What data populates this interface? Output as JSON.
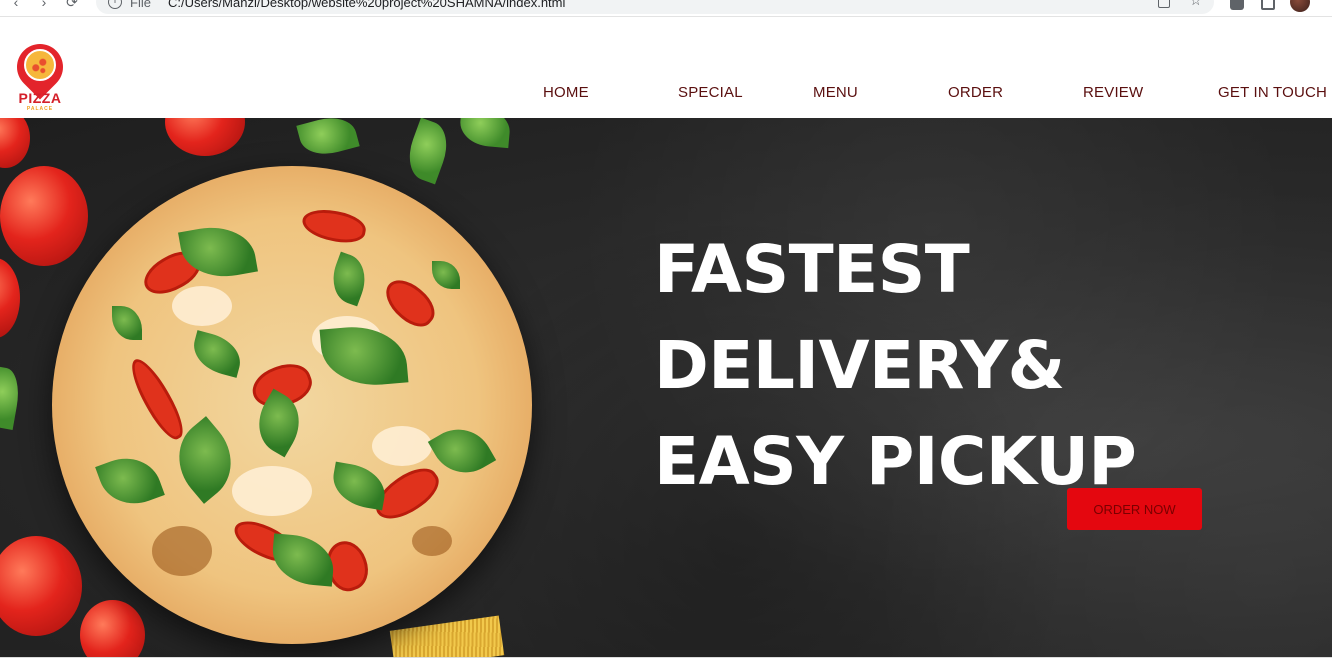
{
  "browser": {
    "protocol_label": "File",
    "url": "C:/Users/Manzi/Desktop/website%20project%20SHAMNA/index.html"
  },
  "logo": {
    "wordmark": "PIZZA",
    "subtext": "PALACE"
  },
  "nav": {
    "items": [
      {
        "label": "HOME"
      },
      {
        "label": "SPECIAL"
      },
      {
        "label": "MENU"
      },
      {
        "label": "ORDER"
      },
      {
        "label": "REVIEW"
      },
      {
        "label": "GET IN TOUCH"
      }
    ]
  },
  "hero": {
    "headline_lines": [
      "FASTEST",
      "DELIVERY&",
      "EASY PICKUP"
    ],
    "cta_label": "ORDER NOW"
  },
  "colors": {
    "nav_text": "#5a0f0f",
    "cta_background": "#e4070f",
    "cta_text": "#7a0000",
    "hero_background": "#2c2c2c"
  }
}
